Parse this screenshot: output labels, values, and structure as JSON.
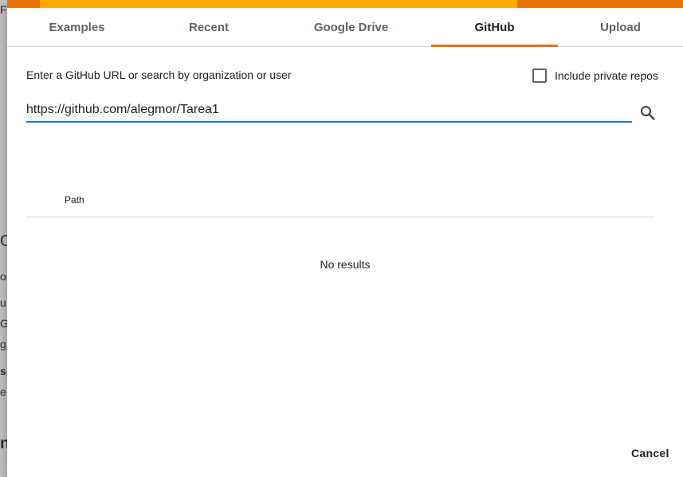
{
  "dialog": {
    "tabs": [
      {
        "label": "Examples",
        "active": false
      },
      {
        "label": "Recent",
        "active": false
      },
      {
        "label": "Google Drive",
        "active": false
      },
      {
        "label": "GitHub",
        "active": true
      },
      {
        "label": "Upload",
        "active": false
      }
    ],
    "github": {
      "prompt": "Enter a GitHub URL or search by organization or user",
      "include_private_label": "Include private repos",
      "include_private_checked": false,
      "search_value": "https://github.com/alegmor/Tarea1",
      "search_icon": "search-icon",
      "columns": [
        "Path"
      ],
      "empty_message": "No results"
    },
    "cancel_label": "Cancel"
  },
  "colors": {
    "accent": "#e8710a",
    "accent_secondary": "#f9ab00",
    "input_focus": "#1a73e8",
    "text": "#202124",
    "muted_text": "#5f6368"
  }
}
